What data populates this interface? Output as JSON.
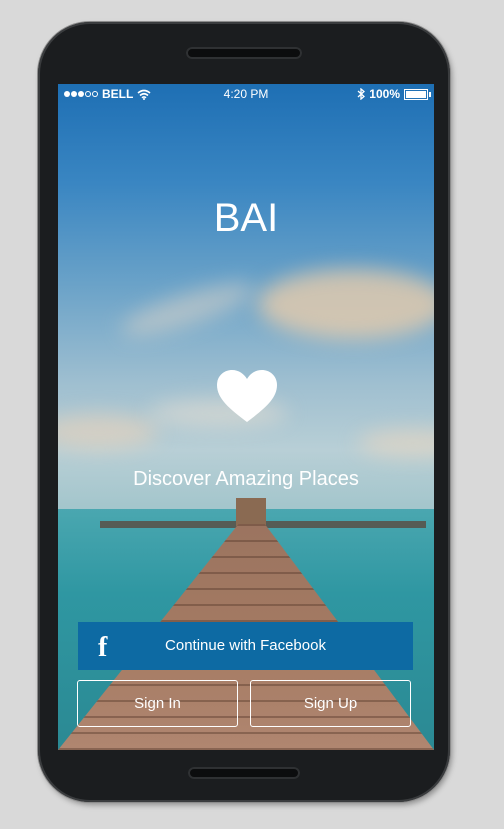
{
  "status_bar": {
    "carrier": "BELL",
    "time": "4:20 PM",
    "battery": "100%"
  },
  "app": {
    "title": "BAI",
    "tagline": "Discover Amazing Places"
  },
  "buttons": {
    "facebook_icon": "f",
    "facebook_label": "Continue with Facebook",
    "sign_in": "Sign In",
    "sign_up": "Sign Up"
  },
  "colors": {
    "facebook_button": "#0d6aa3"
  },
  "icons": {
    "heart": "heart-icon",
    "wifi": "wifi-icon",
    "bluetooth": "bluetooth-icon",
    "battery": "battery-icon",
    "signal": "signal-dots-icon",
    "facebook": "facebook-icon"
  }
}
